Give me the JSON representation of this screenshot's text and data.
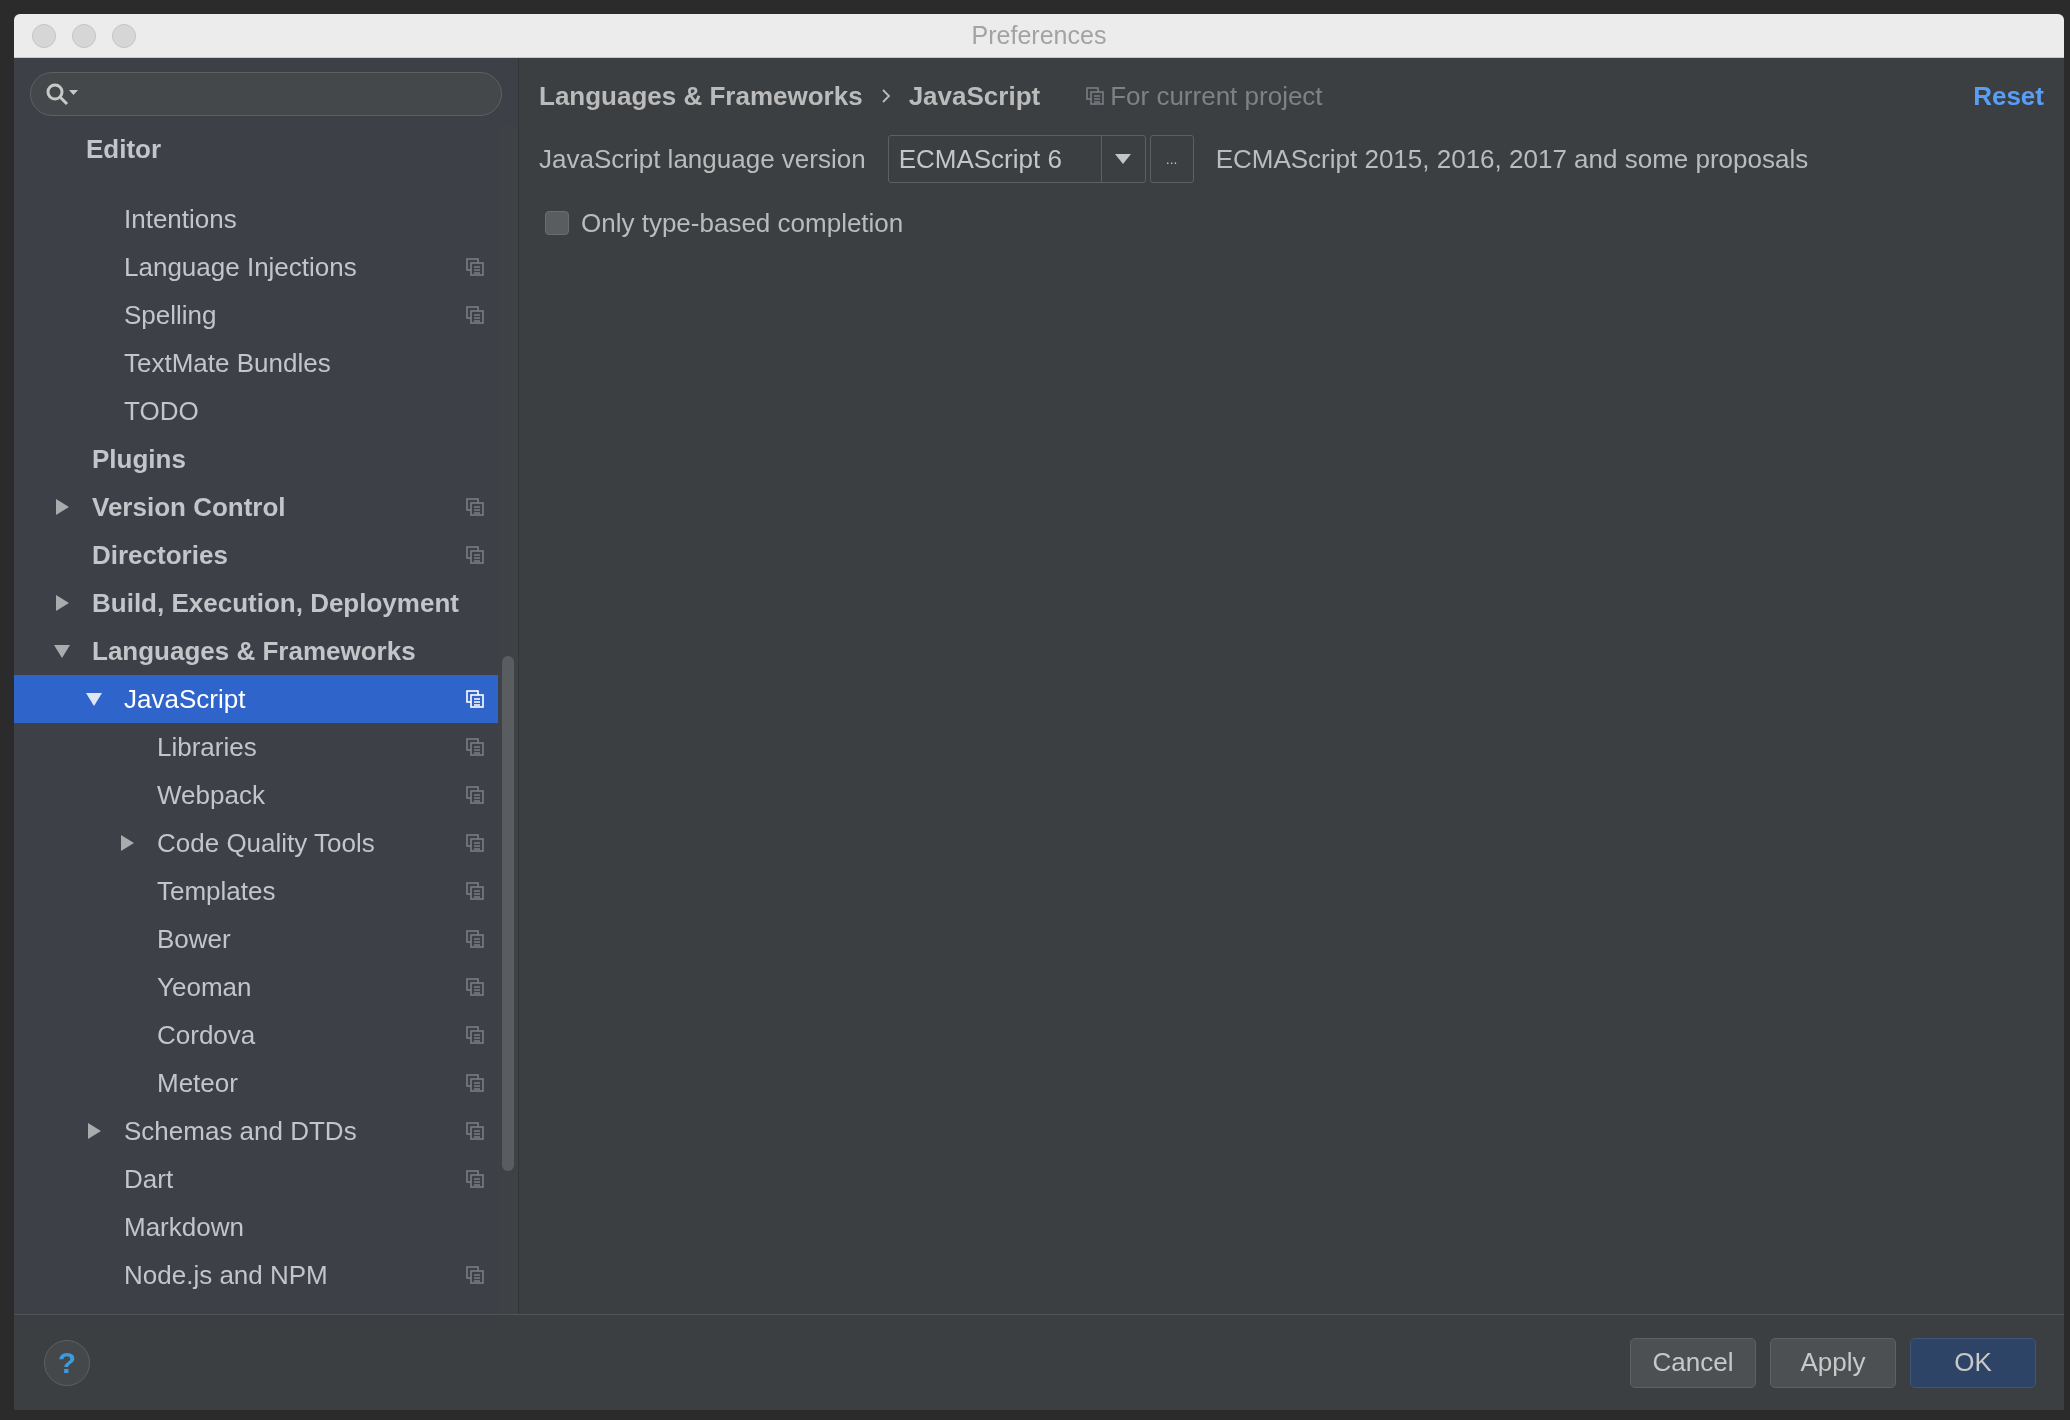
{
  "window": {
    "title": "Preferences"
  },
  "sidebar": {
    "items": [
      {
        "label": "Editor",
        "children": [
          {
            "label": "Intentions",
            "copy": false,
            "selected": false
          },
          {
            "label": "Language Injections",
            "copy": true,
            "selected": false
          },
          {
            "label": "Spelling",
            "copy": true,
            "selected": false
          },
          {
            "label": "TextMate Bundles",
            "copy": false,
            "selected": false
          },
          {
            "label": "TODO",
            "copy": false,
            "selected": false
          }
        ]
      },
      {
        "label": "Plugins",
        "copy": false,
        "selected": false
      },
      {
        "label": "Version Control",
        "copy": true,
        "expanded": false,
        "selected": false
      },
      {
        "label": "Directories",
        "copy": true,
        "selected": false
      },
      {
        "label": "Build, Execution, Deployment",
        "copy": false,
        "expanded": false,
        "selected": false
      },
      {
        "label": "Languages & Frameworks",
        "copy": false,
        "expanded": true,
        "selected": false,
        "children": [
          {
            "label": "JavaScript",
            "copy": true,
            "expanded": true,
            "selected": true,
            "children": [
              {
                "label": "Libraries",
                "copy": true,
                "selected": false
              },
              {
                "label": "Webpack",
                "copy": true,
                "selected": false
              },
              {
                "label": "Code Quality Tools",
                "copy": true,
                "expanded": false,
                "selected": false
              },
              {
                "label": "Templates",
                "copy": true,
                "selected": false
              },
              {
                "label": "Bower",
                "copy": true,
                "selected": false
              },
              {
                "label": "Yeoman",
                "copy": true,
                "selected": false
              },
              {
                "label": "Cordova",
                "copy": true,
                "selected": false
              },
              {
                "label": "Meteor",
                "copy": true,
                "selected": false
              }
            ]
          },
          {
            "label": "Schemas and DTDs",
            "copy": true,
            "expanded": false,
            "selected": false
          },
          {
            "label": "Dart",
            "copy": true,
            "selected": false
          },
          {
            "label": "Markdown",
            "copy": false,
            "selected": false
          },
          {
            "label": "Node.js and NPM",
            "copy": true,
            "selected": false
          }
        ]
      }
    ]
  },
  "breadcrumb": [
    "Languages & Frameworks",
    "JavaScript"
  ],
  "scope_note": "For current project",
  "reset": "Reset",
  "language_version": {
    "label": "JavaScript language version",
    "value": "ECMAScript 6",
    "more": "...",
    "description": "ECMAScript 2015, 2016, 2017 and some proposals"
  },
  "options": [
    {
      "label": "Only type-based completion",
      "checked": false
    }
  ],
  "help": "?",
  "buttons": [
    {
      "label": "Cancel",
      "kind": "secondary"
    },
    {
      "label": "Apply",
      "kind": "secondary"
    },
    {
      "label": "OK",
      "kind": "default"
    }
  ]
}
